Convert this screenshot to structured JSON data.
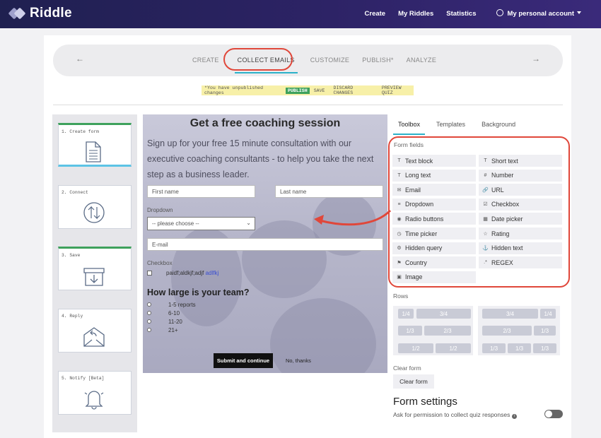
{
  "header": {
    "brand": "Riddle",
    "nav": [
      "Create",
      "My Riddles",
      "Statistics"
    ],
    "account": "My personal account"
  },
  "steps": {
    "items": [
      "CREATE",
      "COLLECT EMAILS",
      "CUSTOMIZE",
      "PUBLISH*",
      "ANALYZE"
    ],
    "active": "COLLECT EMAILS",
    "prev": "←",
    "next": "→"
  },
  "notice": {
    "text": "*You have unpublished changes",
    "publish": "PUBLISH",
    "save": "SAVE",
    "discard": "DISCARD CHANGES",
    "preview": "PREVIEW QUIZ"
  },
  "left_steps": [
    {
      "label": "1. Create form",
      "icon": "document-icon"
    },
    {
      "label": "2. Connect",
      "icon": "sync-arrows-icon"
    },
    {
      "label": "3. Save",
      "icon": "download-box-icon"
    },
    {
      "label": "4. Reply",
      "icon": "reply-envelope-icon"
    },
    {
      "label": "5. Notify [Beta]",
      "icon": "bell-icon"
    }
  ],
  "preview": {
    "title": "Get a free coaching session",
    "subtitle": "Sign up for your free 15 minute consultation with our executive coaching consultants - to help you take the next step as a business leader.",
    "first_name": "First name",
    "last_name": "Last name",
    "dropdown_label": "Dropdown",
    "dropdown_value": "-- please choose --",
    "email": "E-mail",
    "checkbox_label": "Checkbox",
    "checkbox_text": "paidf;aldkjf;adjf",
    "checkbox_link": "adlfkj",
    "question": "How large is your team?",
    "options": [
      "1-5 reports",
      "6-10",
      "11-20",
      "21+"
    ],
    "submit": "Submit and continue",
    "no_thanks": "No, thanks"
  },
  "toolbox": {
    "tabs": [
      "Toolbox",
      "Templates",
      "Background"
    ],
    "active_tab": "Toolbox",
    "form_fields_label": "Form fields",
    "fields": [
      {
        "label": "Text block",
        "icon": "T"
      },
      {
        "label": "Short text",
        "icon": "T"
      },
      {
        "label": "Long text",
        "icon": "T"
      },
      {
        "label": "Number",
        "icon": "#"
      },
      {
        "label": "Email",
        "icon": "✉"
      },
      {
        "label": "URL",
        "icon": "🔗"
      },
      {
        "label": "Dropdown",
        "icon": "≡"
      },
      {
        "label": "Checkbox",
        "icon": "☑"
      },
      {
        "label": "Radio buttons",
        "icon": "◉"
      },
      {
        "label": "Date picker",
        "icon": "▦"
      },
      {
        "label": "Time picker",
        "icon": "◷"
      },
      {
        "label": "Rating",
        "icon": "☆"
      },
      {
        "label": "Hidden query",
        "icon": "⚙"
      },
      {
        "label": "Hidden text",
        "icon": "⚓"
      },
      {
        "label": "Country",
        "icon": "⚑"
      },
      {
        "label": "REGEX",
        "icon": ".*"
      },
      {
        "label": "Image",
        "icon": "▣"
      }
    ],
    "rows_label": "Rows",
    "rows_left": [
      [
        "1/4",
        "3/4"
      ],
      [
        "1/3",
        "2/3"
      ],
      [
        "1/2",
        "1/2"
      ]
    ],
    "rows_right": [
      [
        "3/4",
        "1/4"
      ],
      [
        "2/3",
        "1/3"
      ],
      [
        "1/3",
        "1/3",
        "1/3"
      ]
    ],
    "clear_label": "Clear form",
    "clear_button": "Clear form",
    "settings_title": "Form settings",
    "settings_text": "Ask for permission to collect quiz responses",
    "settings_info": "i"
  },
  "colors": {
    "highlight": "#e0473a",
    "accent": "#2cb1c9",
    "publish": "#3ea15c"
  }
}
